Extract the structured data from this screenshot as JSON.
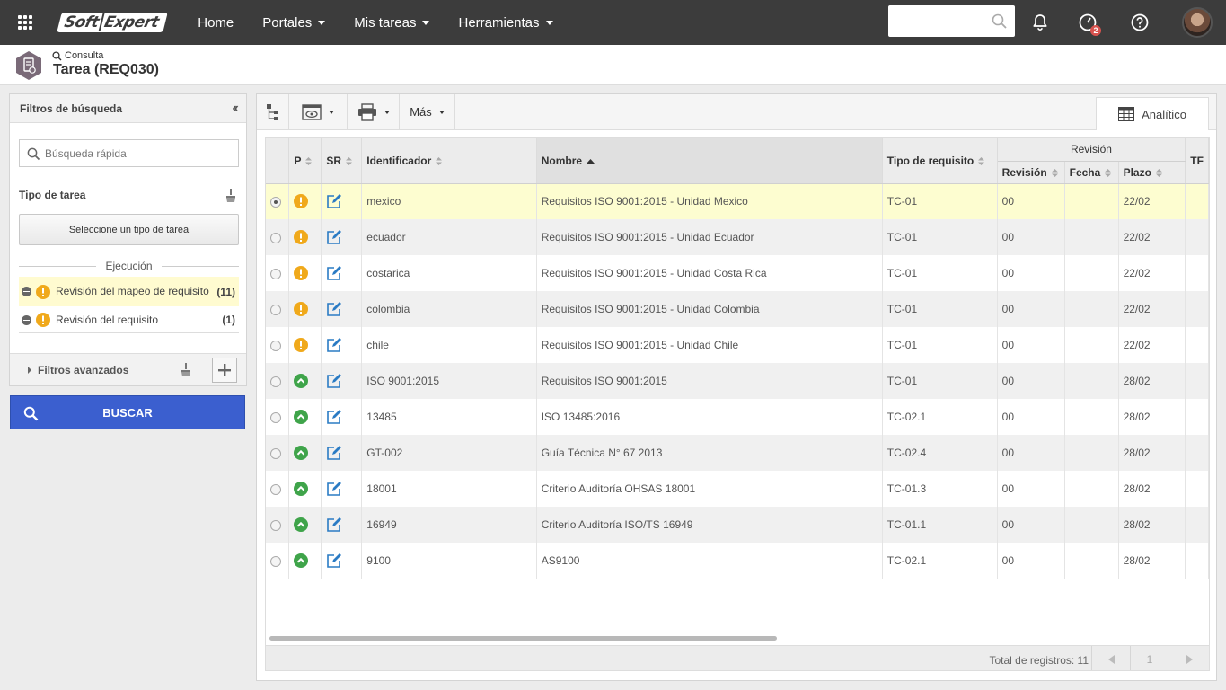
{
  "nav": {
    "logo_soft": "Soft",
    "logo_expert": "Expert",
    "items": [
      "Home",
      "Portales",
      "Mis tareas",
      "Herramientas"
    ],
    "notification_badge": "2"
  },
  "header": {
    "breadcrumb": "Consulta",
    "title": "Tarea (REQ030)"
  },
  "filters": {
    "title": "Filtros de búsqueda",
    "quick_search_placeholder": "Búsqueda rápida",
    "task_type_label": "Tipo de tarea",
    "select_type_button": "Seleccione un tipo de tarea",
    "execution_label": "Ejecución",
    "execution_items": [
      {
        "label": "Revisión del mapeo de requisito",
        "count": "(11)"
      },
      {
        "label": "Revisión del requisito",
        "count": "(1)"
      }
    ],
    "advanced_label": "Filtros avanzados",
    "search_button": "BUSCAR"
  },
  "toolbar": {
    "more_label": "Más",
    "tab_label": "Analítico"
  },
  "grid": {
    "headers": {
      "p": "P",
      "sr": "SR",
      "identificador": "Identificador",
      "nombre": "Nombre",
      "tipo": "Tipo de requisito",
      "revision_group": "Revisión",
      "revision": "Revisión",
      "fecha": "Fecha",
      "plazo": "Plazo",
      "tr": "TF"
    },
    "rows": [
      {
        "status": "warn",
        "id": "mexico",
        "name": "Requisitos ISO 9001:2015 - Unidad Mexico",
        "type": "TC-01",
        "rev": "00",
        "date": "",
        "deadline": "22/02"
      },
      {
        "status": "warn",
        "id": "ecuador",
        "name": "Requisitos ISO 9001:2015 - Unidad Ecuador",
        "type": "TC-01",
        "rev": "00",
        "date": "",
        "deadline": "22/02"
      },
      {
        "status": "warn",
        "id": "costarica",
        "name": "Requisitos ISO 9001:2015 - Unidad Costa Rica",
        "type": "TC-01",
        "rev": "00",
        "date": "",
        "deadline": "22/02"
      },
      {
        "status": "warn",
        "id": "colombia",
        "name": "Requisitos ISO 9001:2015 - Unidad Colombia",
        "type": "TC-01",
        "rev": "00",
        "date": "",
        "deadline": "22/02"
      },
      {
        "status": "warn",
        "id": "chile",
        "name": "Requisitos ISO 9001:2015 - Unidad Chile",
        "type": "TC-01",
        "rev": "00",
        "date": "",
        "deadline": "22/02"
      },
      {
        "status": "ok",
        "id": "ISO 9001:2015",
        "name": "Requisitos ISO 9001:2015",
        "type": "TC-01",
        "rev": "00",
        "date": "",
        "deadline": "28/02"
      },
      {
        "status": "ok",
        "id": "13485",
        "name": "ISO 13485:2016",
        "type": "TC-02.1",
        "rev": "00",
        "date": "",
        "deadline": "28/02"
      },
      {
        "status": "ok",
        "id": "GT-002",
        "name": "Guía Técnica N° 67 2013",
        "type": "TC-02.4",
        "rev": "00",
        "date": "",
        "deadline": "28/02"
      },
      {
        "status": "ok",
        "id": "18001",
        "name": "Criterio Auditoría OHSAS 18001",
        "type": "TC-01.3",
        "rev": "00",
        "date": "",
        "deadline": "28/02"
      },
      {
        "status": "ok",
        "id": "16949",
        "name": "Criterio Auditoría ISO/TS 16949",
        "type": "TC-01.1",
        "rev": "00",
        "date": "",
        "deadline": "28/02"
      },
      {
        "status": "ok",
        "id": "9100",
        "name": "AS9100",
        "type": "TC-02.1",
        "rev": "00",
        "date": "",
        "deadline": "28/02"
      }
    ],
    "selected_row": 0,
    "total_label": "Total de registros: 11",
    "page": "1"
  },
  "colors": {
    "topbar": "#3c3c3c",
    "search_button": "#3b5fcf",
    "warn": "#f0a91b",
    "ok": "#3fa44a",
    "selected_row": "#fdfdd0",
    "edit_icon": "#2a7bc4"
  }
}
